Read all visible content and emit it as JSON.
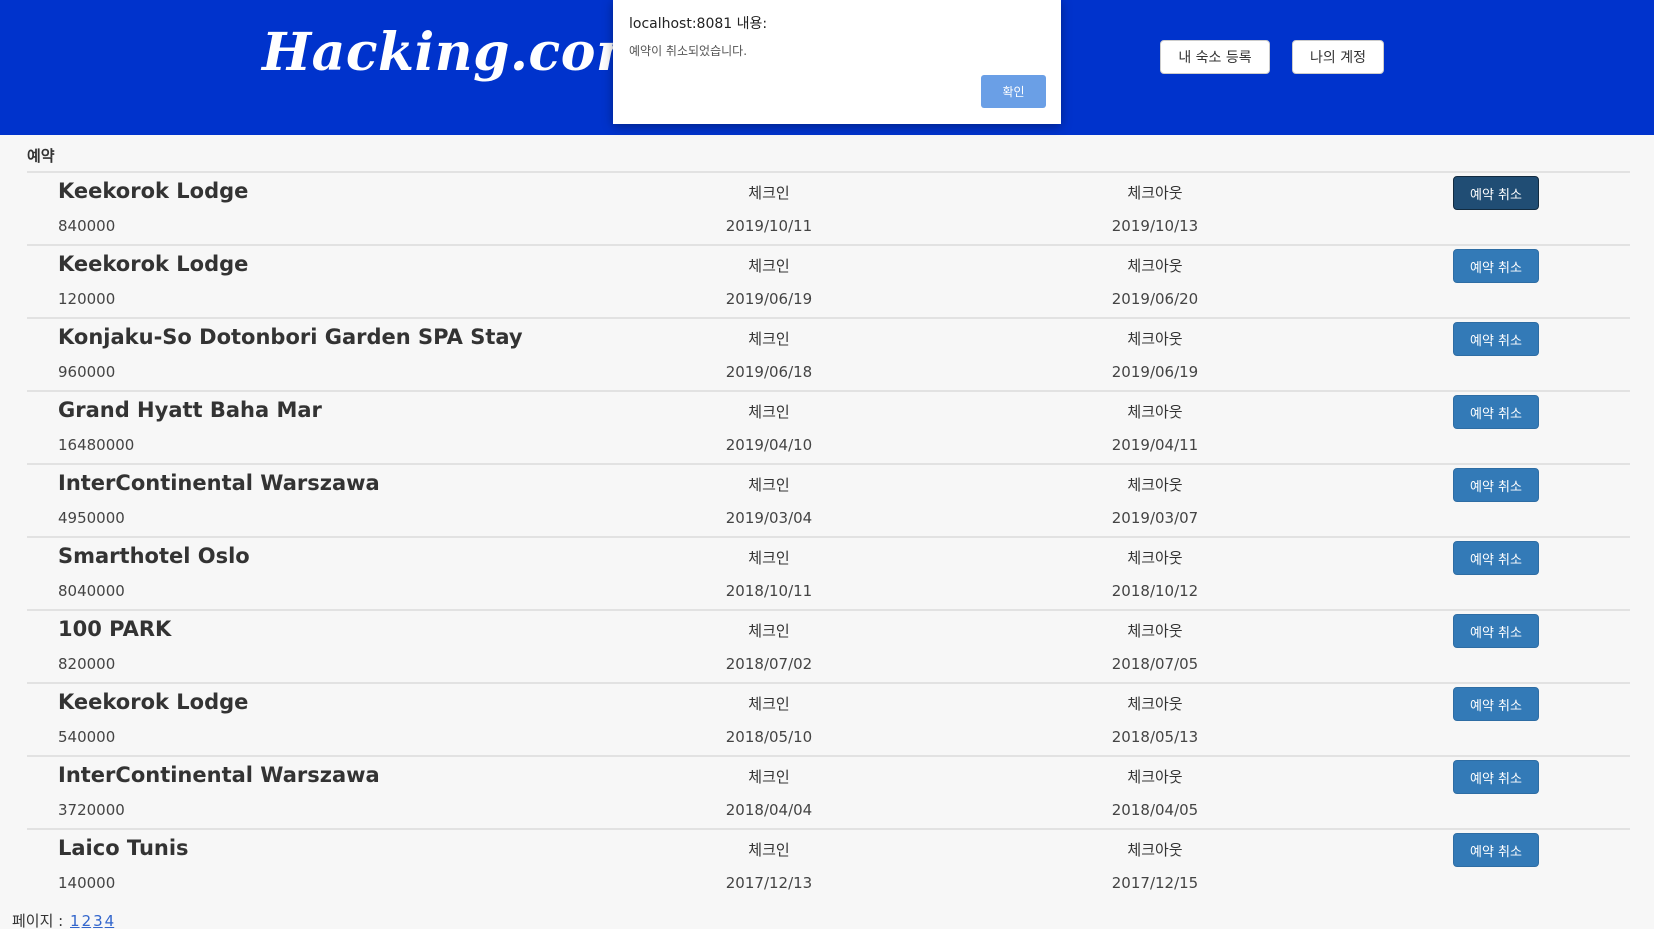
{
  "header": {
    "logo": "Hacking.com",
    "register_button": "내 숙소 등록",
    "account_button": "나의 계정"
  },
  "dialog": {
    "title": "localhost:8081 내용:",
    "message": "예약이 취소되었습니다.",
    "ok_button": "확인"
  },
  "section_label": "예약",
  "column_labels": {
    "checkin": "체크인",
    "checkout": "체크아웃",
    "cancel": "예약 취소"
  },
  "reservations": [
    {
      "name": "Keekorok Lodge",
      "price": "840000",
      "checkin": "2019/10/11",
      "checkout": "2019/10/13"
    },
    {
      "name": "Keekorok Lodge",
      "price": "120000",
      "checkin": "2019/06/19",
      "checkout": "2019/06/20"
    },
    {
      "name": "Konjaku-So Dotonbori Garden SPA Stay",
      "price": "960000",
      "checkin": "2019/06/18",
      "checkout": "2019/06/19"
    },
    {
      "name": "Grand Hyatt Baha Mar",
      "price": "16480000",
      "checkin": "2019/04/10",
      "checkout": "2019/04/11"
    },
    {
      "name": "InterContinental Warszawa",
      "price": "4950000",
      "checkin": "2019/03/04",
      "checkout": "2019/03/07"
    },
    {
      "name": "Smarthotel Oslo",
      "price": "8040000",
      "checkin": "2018/10/11",
      "checkout": "2018/10/12"
    },
    {
      "name": "100 PARK",
      "price": "820000",
      "checkin": "2018/07/02",
      "checkout": "2018/07/05"
    },
    {
      "name": "Keekorok Lodge",
      "price": "540000",
      "checkin": "2018/05/10",
      "checkout": "2018/05/13"
    },
    {
      "name": "InterContinental Warszawa",
      "price": "3720000",
      "checkin": "2018/04/04",
      "checkout": "2018/04/05"
    },
    {
      "name": "Laico Tunis",
      "price": "140000",
      "checkin": "2017/12/13",
      "checkout": "2017/12/15"
    }
  ],
  "pager": {
    "label": "페이지 :",
    "pages": [
      "1",
      "2",
      "3",
      "4"
    ]
  },
  "colors": {
    "header_bg": "#0033cc",
    "button_primary": "#337ab7",
    "button_active": "#204d74",
    "dialog_ok": "#6a9fe6"
  }
}
